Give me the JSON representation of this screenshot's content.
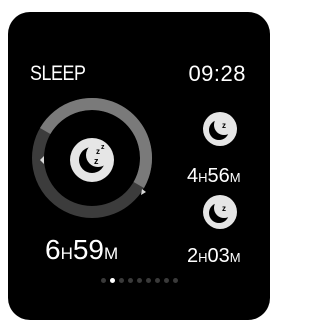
{
  "header": {
    "title": "SLEEP",
    "time": "09:28"
  },
  "summary": {
    "total_hours": "6",
    "hour_unit": "H",
    "total_minutes": "59",
    "minute_unit": "M",
    "icon": "moon-sleep-icon"
  },
  "breakdown": [
    {
      "icon": "moon-sleep-icon",
      "hours": "4",
      "hour_unit": "H",
      "minutes": "56",
      "minute_unit": "M"
    },
    {
      "icon": "moon-sleep-icon",
      "hours": "2",
      "hour_unit": "H",
      "minutes": "03",
      "minute_unit": "M"
    }
  ],
  "pager": {
    "page_count": 9,
    "active_index": 1
  },
  "colors": {
    "background": "#000000",
    "ring_track": "#3c3c3c",
    "ring_progress": "#7a7a7a",
    "icon_fill": "#e6e6e6",
    "text": "#ffffff",
    "dot_inactive": "#3a3a3a",
    "dot_active": "#ffffff"
  }
}
